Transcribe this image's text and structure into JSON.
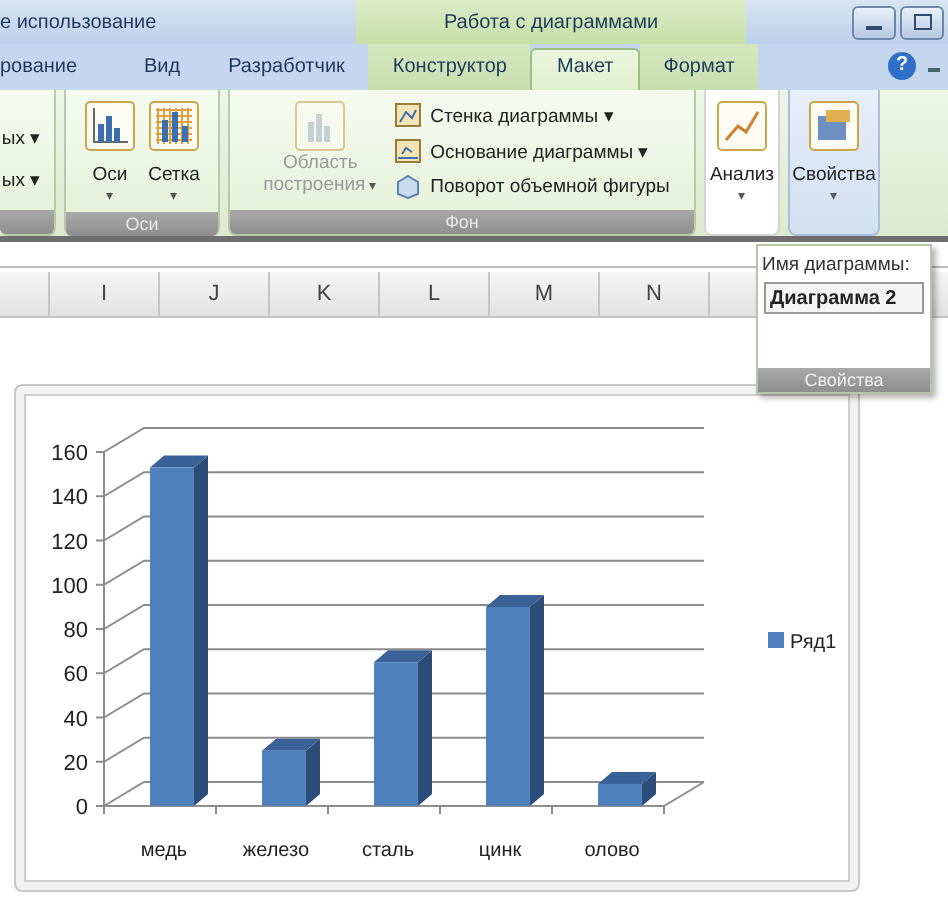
{
  "title_bar": {
    "left_text": "е использование",
    "context_title": "Работа с диаграммами"
  },
  "help": "?",
  "tabs": [
    {
      "label": "рование",
      "selected": false,
      "context": false
    },
    {
      "label": "Вид",
      "selected": false,
      "context": false
    },
    {
      "label": "Разработчик",
      "selected": false,
      "context": false
    },
    {
      "label": "Конструктор",
      "selected": false,
      "context": true
    },
    {
      "label": "Макет",
      "selected": true,
      "context": true
    },
    {
      "label": "Формат",
      "selected": false,
      "context": true
    }
  ],
  "ribbon_groups": [
    {
      "kind": "small",
      "items": [
        {
          "label": "ых",
          "arrow": "▾"
        },
        {
          "label": "ых",
          "arrow": "▾"
        }
      ]
    },
    {
      "kind": "large",
      "footer": "Оси",
      "items": [
        {
          "label": "Оси",
          "arrow": "▾",
          "disabled": false
        },
        {
          "label": "Сетка",
          "arrow": "▾",
          "disabled": false
        }
      ]
    },
    {
      "kind": "mixed",
      "footer": "Фон",
      "items": [
        {
          "label": "Область построения",
          "arrow": "▾",
          "disabled": true
        }
      ],
      "small_items": [
        {
          "label": "Стенка диаграммы",
          "arrow": "▾"
        },
        {
          "label": "Основание диаграммы",
          "arrow": "▾"
        },
        {
          "label": "Поворот объемной фигуры"
        }
      ]
    },
    {
      "kind": "large",
      "open": false,
      "items": [
        {
          "label": "Анализ",
          "arrow": "▾",
          "disabled": false
        }
      ]
    },
    {
      "kind": "large",
      "open": true,
      "items": [
        {
          "label": "Свойства",
          "arrow": "▾",
          "disabled": false
        }
      ]
    }
  ],
  "columns": [
    "I",
    "J",
    "K",
    "L",
    "M",
    "N"
  ],
  "properties_popup": {
    "label": "Имя диаграммы:",
    "value": "Диаграмма 2",
    "footer": "Свойства"
  },
  "chart": {
    "chart_data": {
      "type": "bar",
      "categories": [
        "медь",
        "железо",
        "сталь",
        "цинк",
        "олово"
      ],
      "series": [
        {
          "name": "Ряд1",
          "color": "#4f81bd",
          "values": [
            153,
            25,
            65,
            90,
            10
          ]
        }
      ],
      "ylim": [
        0,
        160
      ],
      "yticks": [
        0,
        20,
        40,
        60,
        80,
        100,
        120,
        140,
        160
      ]
    }
  }
}
